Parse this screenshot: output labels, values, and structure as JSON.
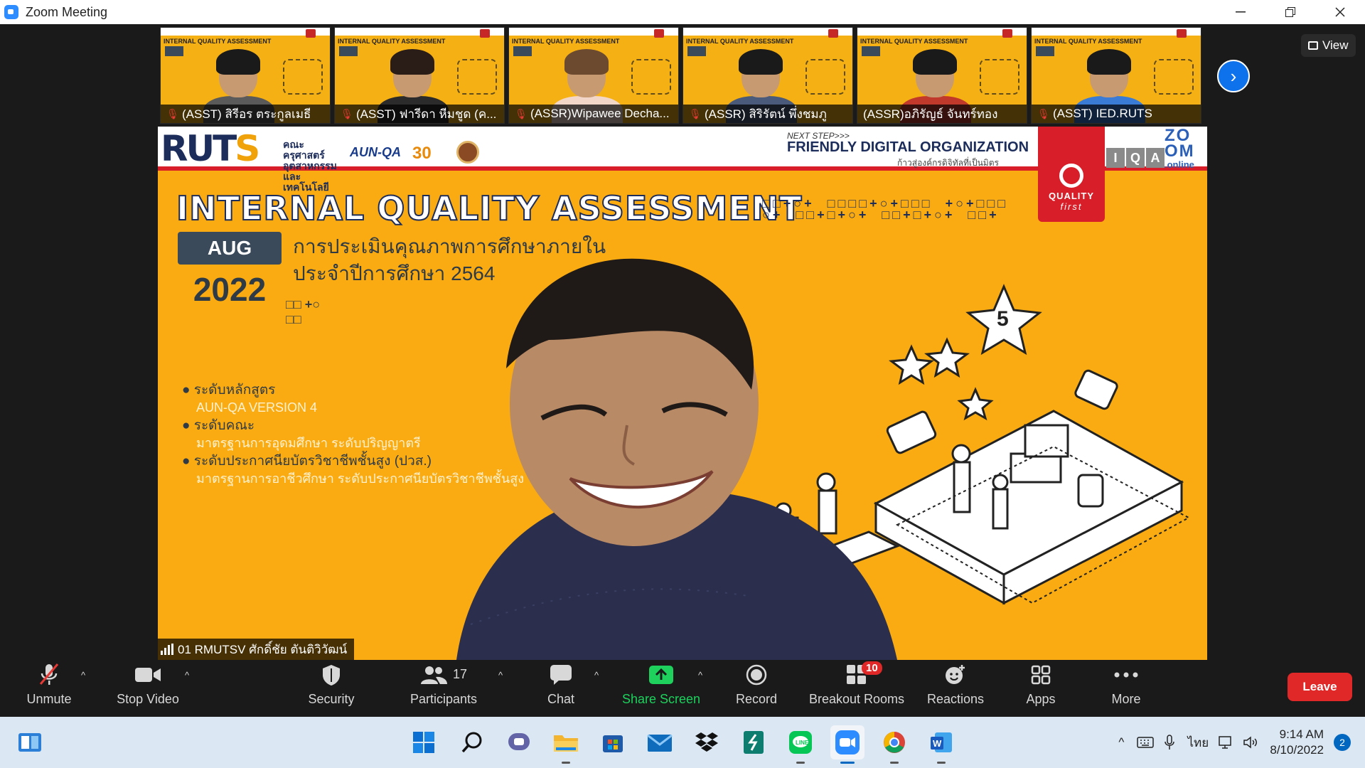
{
  "window": {
    "title": "Zoom Meeting",
    "controls": [
      "minimize",
      "restore",
      "close"
    ]
  },
  "gallery": {
    "participants": [
      {
        "name": "(ASST) สิรีอร ตระกูลเมธี",
        "muted": true
      },
      {
        "name": "(ASST) ฟารีดา หีมชูด (ค...",
        "muted": true
      },
      {
        "name": "(ASSR)Wipawee Decha...",
        "muted": true
      },
      {
        "name": "(ASSR) สิริรัตน์ พึ่งชมภู",
        "muted": true
      },
      {
        "name": "(ASSR)อภิรัญธ์ จันทร์ทอง",
        "muted": false
      },
      {
        "name": "(ASST) IED.RUTS",
        "muted": true
      }
    ],
    "view_label": "View"
  },
  "slide": {
    "brand": "RUTS",
    "faculty": "คณะครุศาสตร์อุตสาหกรรมและเทคโนโลยี",
    "aunqa": "AUN-QA",
    "anniversary": "30",
    "next_step": "NEXT STEP>>>",
    "friendly": "FRIENDLY DIGITAL ORGANIZATION",
    "friendly_sub": "ก้าวสู่องค์กรดิจิทัลที่เป็นมิตร",
    "quality_1": "QUALITY",
    "quality_2": "first",
    "iqa": [
      "I",
      "Q",
      "A"
    ],
    "zoom_1": "ZO",
    "zoom_2": "OM",
    "online": ".online",
    "title": "INTERNAL QUALITY ASSESSMENT",
    "deco": "□□+○+  □□□□+○+□□□  +○+□□□\n○+  □□+□+○+  □□+□+○+  □□+",
    "month": "AUG",
    "year": "2022",
    "thai_line1": "การประเมินคุณภาพการศึกษาภายใน",
    "thai_line2": "ประจำปีการศึกษา 2564",
    "mini_dots": "□□ +○\n□□",
    "bullets": [
      {
        "head": "ระดับหลักสูตร",
        "sub": "AUN-QA VERSION 4"
      },
      {
        "head": "ระดับคณะ",
        "sub": "มาตรฐานการอุดมศึกษา ระดับปริญญาตรี"
      },
      {
        "head": "ระดับประกาศนียบัตรวิชาชีพชั้นสูง (ปวส.)",
        "sub": "มาตรฐานการอาชีวศึกษา ระดับประกาศนียบัตรวิชาชีพชั้นสูง"
      }
    ],
    "star_number": "5"
  },
  "speaker": {
    "label": "01 RMUTSV ศักดิ์ชัย ตันติวิวัฒน์"
  },
  "toolbar": {
    "unmute": "Unmute",
    "stop_video": "Stop Video",
    "security": "Security",
    "participants": "Participants",
    "participant_count": "17",
    "chat": "Chat",
    "share_screen": "Share Screen",
    "record": "Record",
    "breakout_rooms": "Breakout Rooms",
    "breakout_badge": "10",
    "reactions": "Reactions",
    "apps": "Apps",
    "more": "More",
    "leave": "Leave"
  },
  "taskbar": {
    "apps": [
      "widgets",
      "start",
      "search",
      "teams-chat",
      "file-explorer",
      "microsoft-store",
      "mail",
      "dropbox",
      "sway",
      "line",
      "zoom",
      "chrome",
      "word"
    ],
    "time": "9:14 AM",
    "date": "8/10/2022",
    "language": "ไทย",
    "notifications": "2"
  },
  "colors": {
    "slide_orange": "#f9ab11",
    "navy": "#1c2c5b",
    "brand_red": "#d81e28",
    "share_green": "#1dd15c",
    "leave_red": "#e02828",
    "zoom_blue": "#0e72ed"
  }
}
